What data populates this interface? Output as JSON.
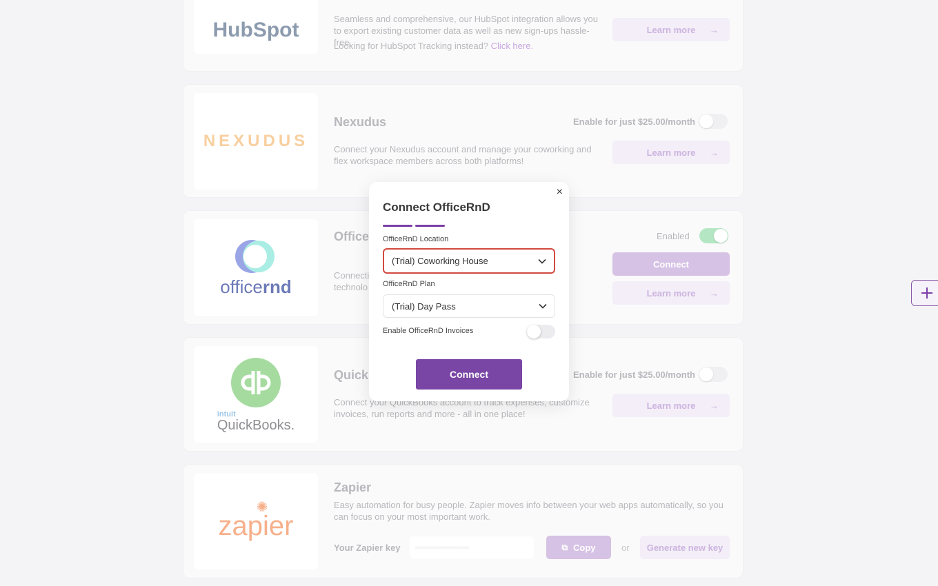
{
  "hubspot": {
    "logo_text": "HubSpot",
    "description": "Seamless and comprehensive, our HubSpot integration allows you to export existing customer data as well as new sign-ups hassle-free.",
    "tracking_text": "Looking for HubSpot Tracking instead?",
    "tracking_link": "Click here.",
    "learn_more": "Learn more"
  },
  "nexudus": {
    "logo_text": "NEXUDUS",
    "title": "Nexudus",
    "enable_label": "Enable for just $25.00/month",
    "description": "Connect your Nexudus account and manage your coworking and flex workspace members across both platforms!",
    "learn_more": "Learn more"
  },
  "officernd": {
    "logo_text_a": "office",
    "logo_text_b": "rnd",
    "title": "OfficeRnD",
    "enabled_label": "Enabled",
    "description_start": "Connecti",
    "description_line2": "technolo",
    "connect": "Connect",
    "learn_more": "Learn more"
  },
  "quickbooks": {
    "logo_brand": "intuit",
    "logo_name": "QuickBooks.",
    "title": "QuickBooks",
    "enable_label": "Enable for just $25.00/month",
    "description_line1": "Connect your QuickBooks account to track expenses, customize",
    "description_line2": "invoices, run reports and more - all in one place!",
    "learn_more": "Learn more"
  },
  "zapier": {
    "logo_text": "zapier",
    "title": "Zapier",
    "description": "Easy automation for busy people. Zapier moves info between your web apps automatically, so you can focus on your most important work.",
    "key_label": "Your Zapier key",
    "copy": "Copy",
    "or": "or",
    "generate": "Generate new key"
  },
  "modal": {
    "close": "×",
    "title": "Connect OfficeRnD",
    "location_label": "OfficeRnD Location",
    "location_value": "(Trial) Coworking House",
    "plan_label": "OfficeRnD Plan",
    "plan_value": "(Trial) Day Pass",
    "invoices_label": "Enable OfficeRnD Invoices",
    "connect": "Connect"
  },
  "colors": {
    "accent": "#7a46a5",
    "highlight": "#d24a3f",
    "enabled_toggle": "#b5e6c4"
  }
}
